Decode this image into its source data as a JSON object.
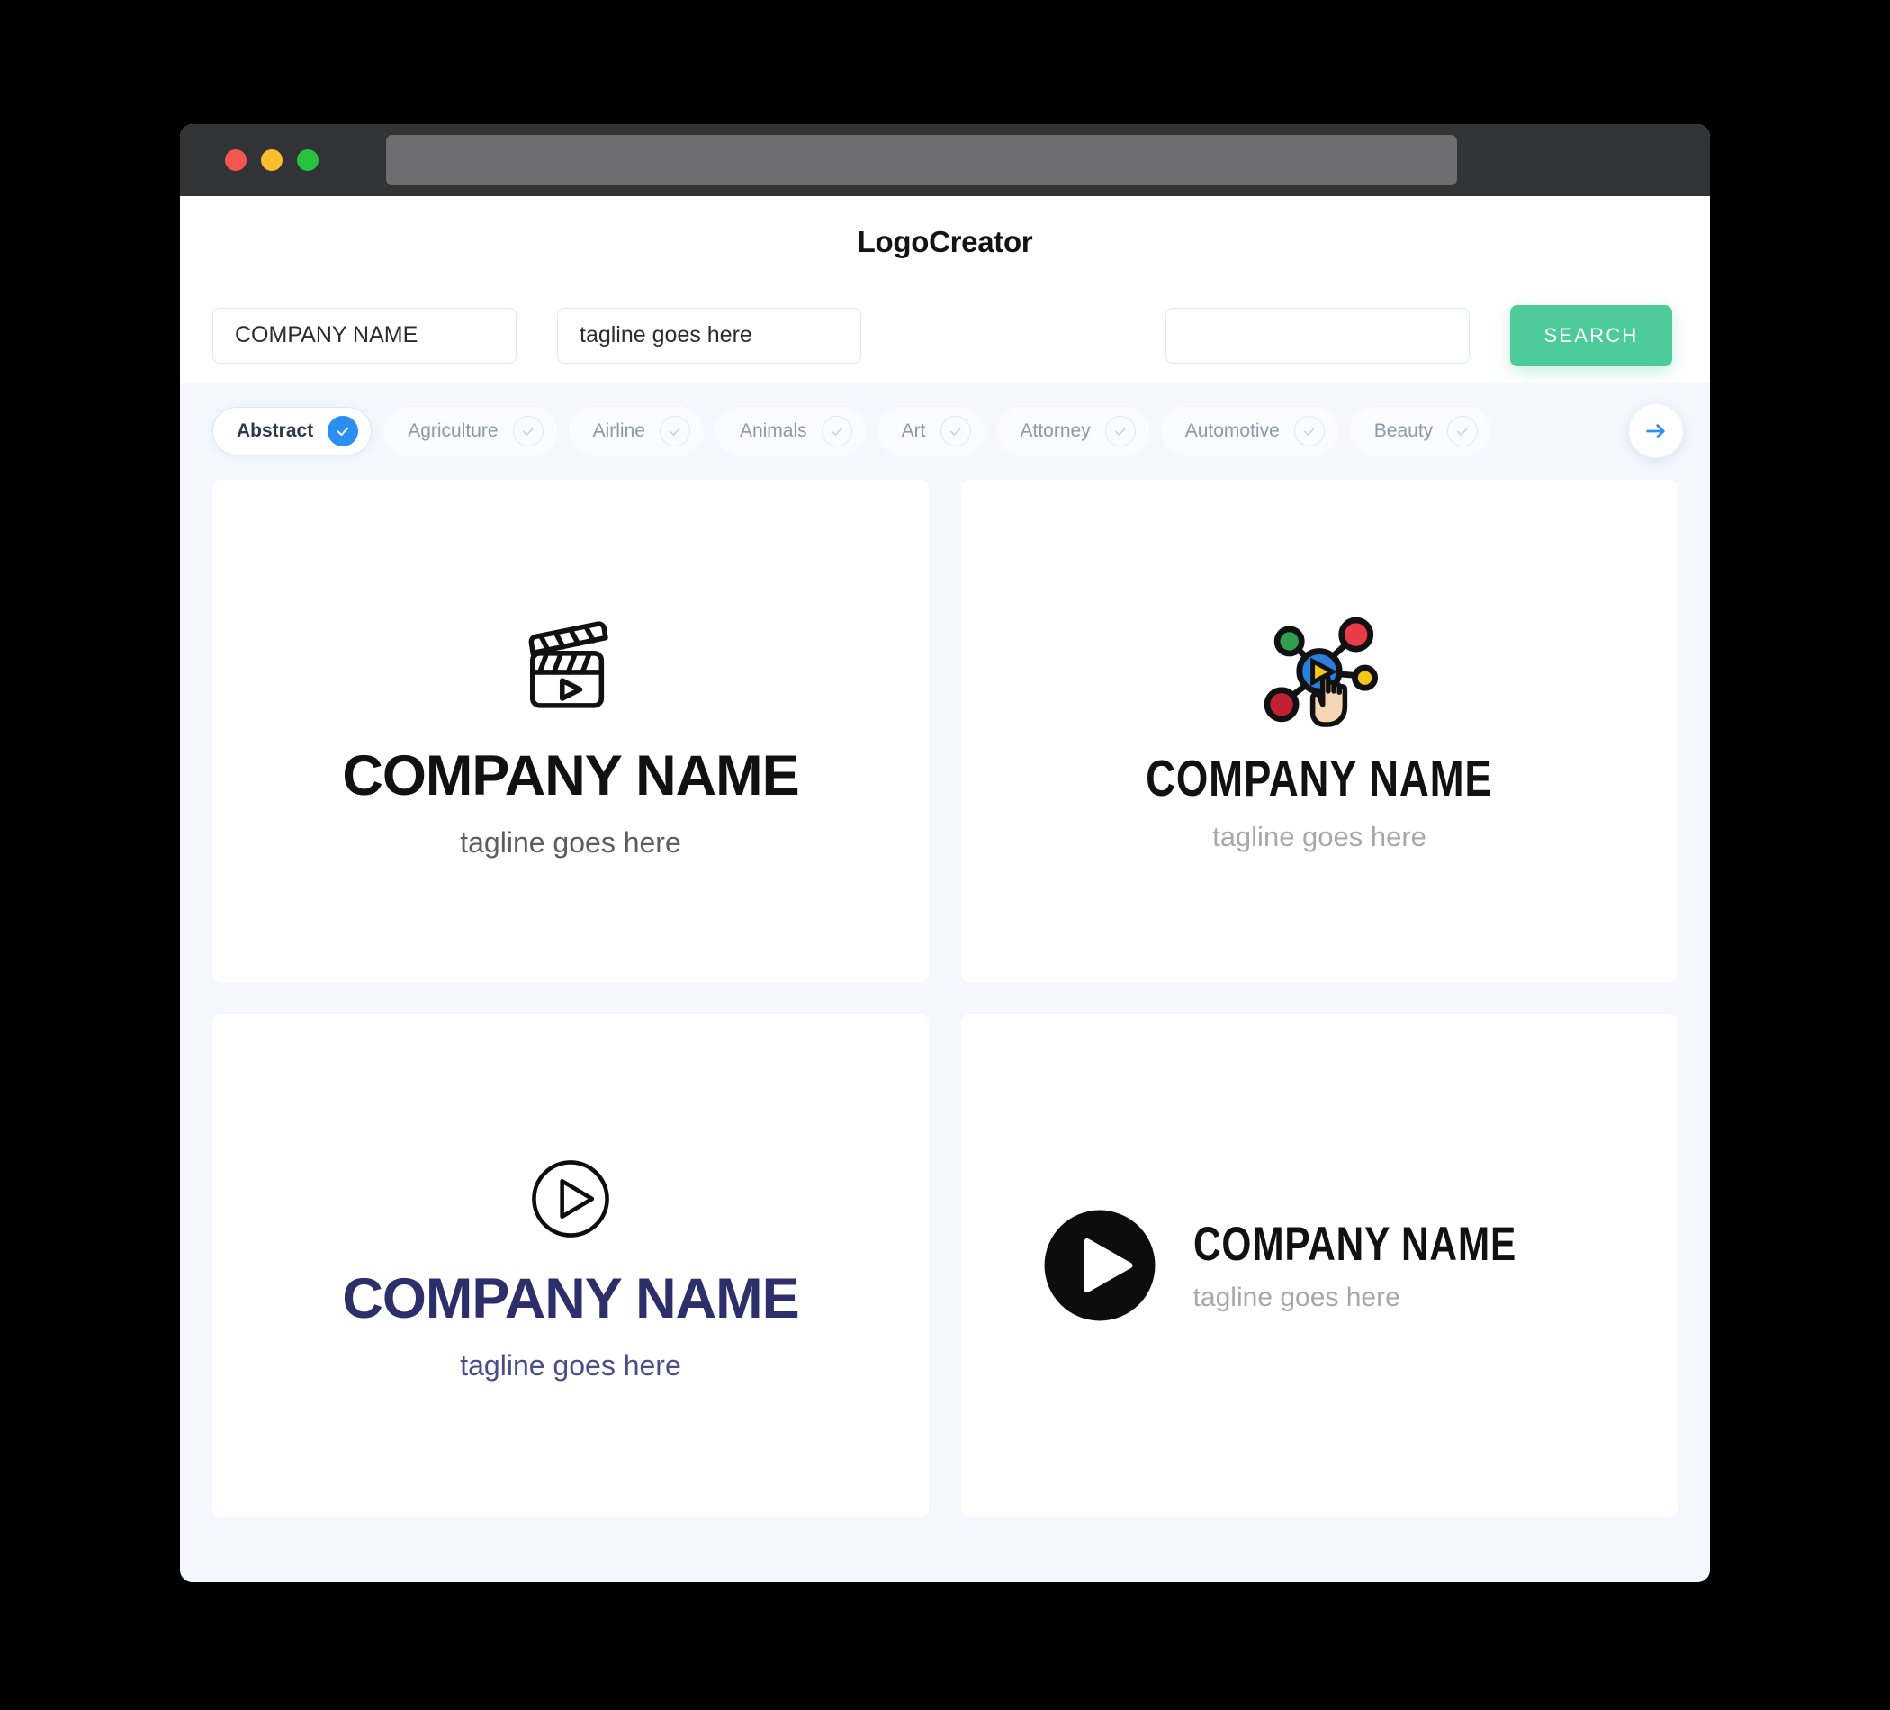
{
  "browser": {
    "traffic_lights": [
      "close",
      "minimize",
      "maximize"
    ],
    "url_value": ""
  },
  "header": {
    "brand": "LogoCreator"
  },
  "search": {
    "company_value": "COMPANY NAME",
    "company_placeholder": "COMPANY NAME",
    "tagline_value": "tagline goes here",
    "tagline_placeholder": "tagline goes here",
    "keyword_value": "",
    "keyword_placeholder": "",
    "button_label": "SEARCH",
    "button_color": "#4ecb9b"
  },
  "categories": {
    "next_label": "Next categories",
    "active_index": 0,
    "items": [
      {
        "label": "Abstract",
        "selected": true
      },
      {
        "label": "Agriculture",
        "selected": false
      },
      {
        "label": "Airline",
        "selected": false
      },
      {
        "label": "Animals",
        "selected": false
      },
      {
        "label": "Art",
        "selected": false
      },
      {
        "label": "Attorney",
        "selected": false
      },
      {
        "label": "Automotive",
        "selected": false
      },
      {
        "label": "Beauty",
        "selected": false
      }
    ]
  },
  "results": {
    "cards": [
      {
        "mark": "clapperboard-play-icon",
        "name": "COMPANY NAME",
        "tagline": "tagline goes here",
        "name_color": "#111111",
        "tagline_color": "#5d5d5d",
        "layout": "stacked"
      },
      {
        "mark": "network-node-cursor-icon",
        "name": "COMPANY NAME",
        "tagline": "tagline goes here",
        "name_color": "#111111",
        "tagline_color": "#a8a8a8",
        "layout": "stacked",
        "mark_colors": {
          "center": "#2a7fdb",
          "play": "#f5c518",
          "node_green": "#2f9e4f",
          "node_red": "#ea3b48",
          "node_darkred": "#c32033",
          "node_yellow": "#f5c518",
          "hand": "#f3d6b3"
        }
      },
      {
        "mark": "play-circle-outline-icon",
        "name": "COMPANY NAME",
        "tagline": "tagline goes here",
        "name_color": "#2d2f6b",
        "tagline_color": "#4b4d86",
        "layout": "stacked"
      },
      {
        "mark": "play-circle-solid-icon",
        "name": "COMPANY NAME",
        "tagline": "tagline goes here",
        "name_color": "#111111",
        "tagline_color": "#a8a8a8",
        "layout": "horizontal"
      }
    ]
  }
}
